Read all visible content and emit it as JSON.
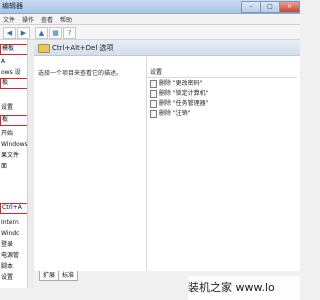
{
  "window": {
    "title": "编辑器"
  },
  "menu": [
    "文件",
    "操作",
    "查看",
    "帮助"
  ],
  "toolbar": {
    "buttons": [
      "back",
      "forward",
      "up",
      "show-hide",
      "help"
    ]
  },
  "tree": {
    "items": [
      {
        "label": "模板",
        "highlighted": true
      },
      {
        "label": "A"
      },
      {
        "label": "ows 设"
      },
      {
        "label": "板",
        "highlighted": true
      },
      {
        "label": ""
      },
      {
        "label": "设置"
      },
      {
        "label": "板",
        "highlighted": true
      },
      {
        "label": "开始"
      },
      {
        "label": "Windows"
      },
      {
        "label": "果文件"
      },
      {
        "label": "面"
      },
      {
        "label": ""
      },
      {
        "label": "Ctrl+A",
        "highlighted": true
      },
      {
        "label": "Intern"
      },
      {
        "label": "Windc"
      },
      {
        "label": "登录"
      },
      {
        "label": "电源管"
      },
      {
        "label": "脚本"
      },
      {
        "label": "设置"
      }
    ]
  },
  "content": {
    "header_title": "Ctrl+Alt+Del 选项",
    "description": "选择一个项目来查看它的描述。",
    "list_header": "设置",
    "items": [
      "删除 \"更改密码\"",
      "删除 \"锁定计算机\"",
      "删除 \"任务管理器\"",
      "删除 \"注销\""
    ]
  },
  "tabs": [
    "扩展",
    "标准"
  ],
  "watermark": {
    "text": "装机之家 www.lo"
  }
}
